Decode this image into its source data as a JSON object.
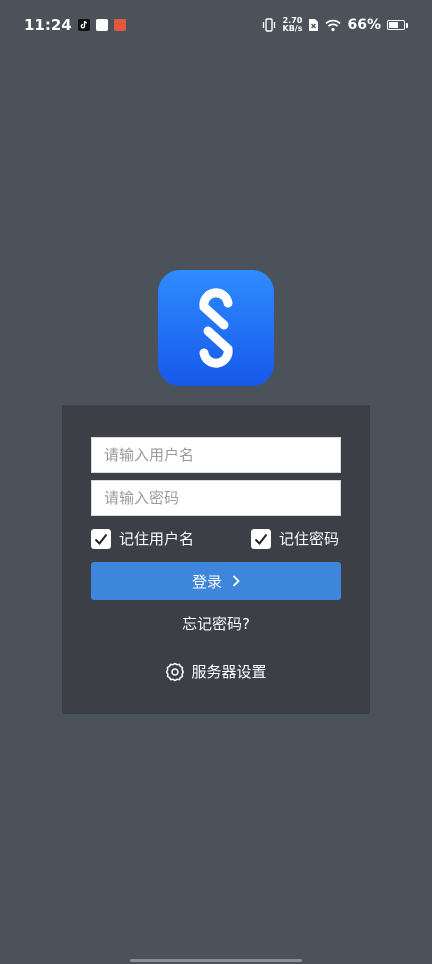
{
  "status": {
    "time": "11:24",
    "net_speed_value": "2.70",
    "net_speed_unit": "KB/s",
    "battery_text": "66%",
    "battery_level": 0.66
  },
  "login": {
    "username_placeholder": "请输入用户名",
    "password_placeholder": "请输入密码",
    "remember_username_label": "记住用户名",
    "remember_password_label": "记住密码",
    "login_label": "登录",
    "forgot_label": "忘记密码?",
    "server_label": "服务器设置"
  },
  "colors": {
    "background": "#4b5259",
    "panel": "#3c4046",
    "primary": "#3d86dc"
  }
}
